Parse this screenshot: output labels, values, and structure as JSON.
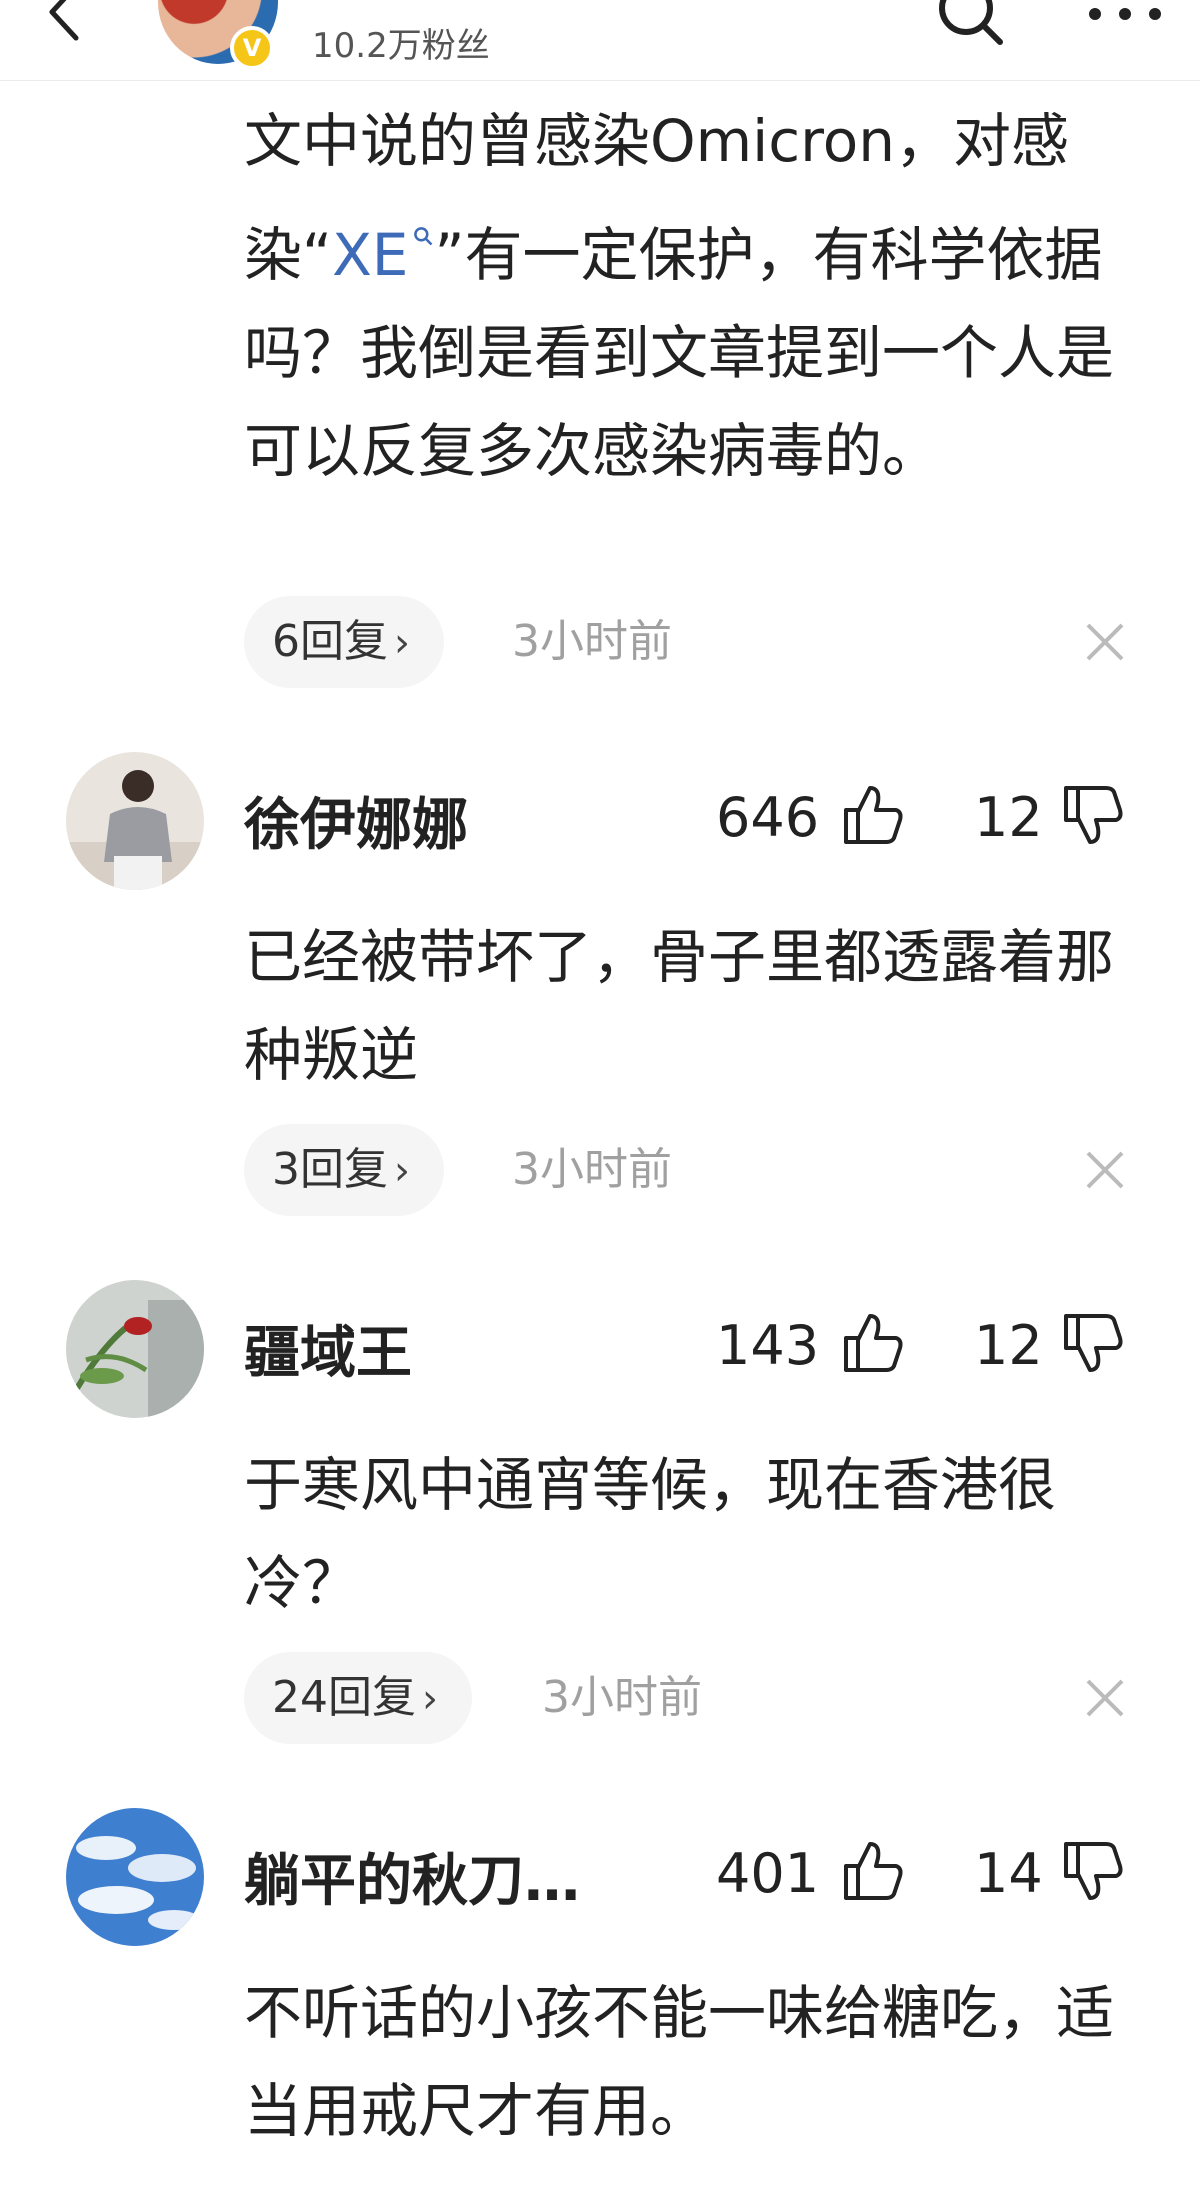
{
  "header": {
    "title": "",
    "fans": "10.2万粉丝"
  },
  "comments": [
    {
      "text_prefix": "文中说的曾感染Omicron，对感染“",
      "link_text": "XE",
      "link_icon": "search-icon",
      "text_suffix": "”有一定保护，有科学依据吗？我倒是看到文章提到一个人是可以反复多次感染病毒的。",
      "replies": "6回复",
      "time": "3小时前"
    },
    {
      "username": "徐伊娜娜",
      "likes": "646",
      "dislikes": "12",
      "text": "已经被带坏了，骨子里都透露着那种叛逆",
      "replies": "3回复",
      "time": "3小时前"
    },
    {
      "username": "疆域王",
      "likes": "143",
      "dislikes": "12",
      "text": "于寒风中通宵等候，现在香港很冷？",
      "replies": "24回复",
      "time": "3小时前"
    },
    {
      "username": "躺平的秋刀…",
      "likes": "401",
      "dislikes": "14",
      "text": "不听话的小孩不能一味给糖吃，适当用戒尺才有用。"
    }
  ],
  "ui": {
    "chevron": "›",
    "verified_badge": "V"
  },
  "colors": {
    "link": "#3e6bb7",
    "time": "#a0a0a0",
    "pill": "#f5f5f5"
  }
}
